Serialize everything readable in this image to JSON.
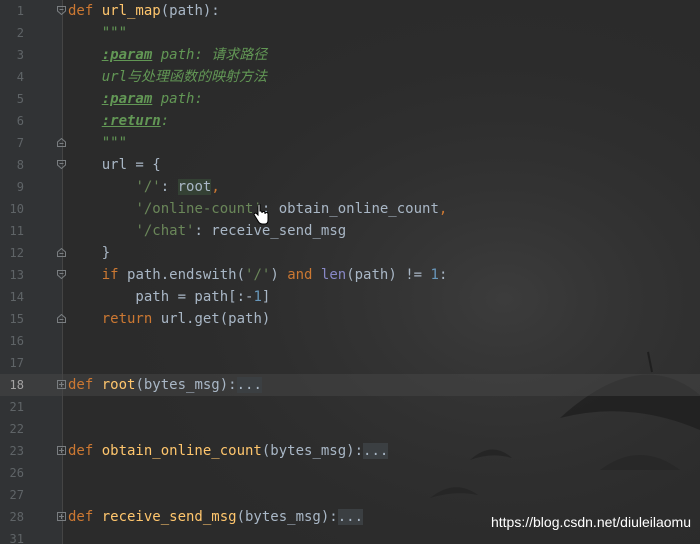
{
  "editor": {
    "lines": [
      {
        "number": "1",
        "fold": "open",
        "tokens": [
          {
            "t": "def ",
            "c": "kw"
          },
          {
            "t": "url_map",
            "c": "fn"
          },
          {
            "t": "(path):",
            "c": "plain"
          }
        ]
      },
      {
        "number": "2",
        "fold": "",
        "tokens": [
          {
            "t": "    \"\"\"",
            "c": "doc"
          }
        ]
      },
      {
        "number": "3",
        "fold": "",
        "tokens": [
          {
            "t": "    ",
            "c": "plain"
          },
          {
            "t": ":param",
            "c": "tag"
          },
          {
            "t": " path: 请求路径",
            "c": "doc"
          }
        ]
      },
      {
        "number": "4",
        "fold": "",
        "tokens": [
          {
            "t": "    url与处理函数的映射方法",
            "c": "doc"
          }
        ]
      },
      {
        "number": "5",
        "fold": "",
        "tokens": [
          {
            "t": "    ",
            "c": "plain"
          },
          {
            "t": ":param",
            "c": "tag"
          },
          {
            "t": " path:",
            "c": "doc"
          }
        ]
      },
      {
        "number": "6",
        "fold": "",
        "tokens": [
          {
            "t": "    ",
            "c": "plain"
          },
          {
            "t": ":return",
            "c": "tag"
          },
          {
            "t": ":",
            "c": "doc"
          }
        ]
      },
      {
        "number": "7",
        "fold": "close",
        "tokens": [
          {
            "t": "    \"\"\"",
            "c": "doc"
          }
        ]
      },
      {
        "number": "8",
        "fold": "open",
        "tokens": [
          {
            "t": "    url = {",
            "c": "plain"
          }
        ]
      },
      {
        "number": "9",
        "fold": "",
        "tokens": [
          {
            "t": "        ",
            "c": "plain"
          },
          {
            "t": "'/'",
            "c": "str"
          },
          {
            "t": ": ",
            "c": "plain"
          },
          {
            "t": "root",
            "c": "hl"
          },
          {
            "t": ",",
            "c": "kw"
          }
        ]
      },
      {
        "number": "10",
        "fold": "",
        "tokens": [
          {
            "t": "        ",
            "c": "plain"
          },
          {
            "t": "'/online-count'",
            "c": "str"
          },
          {
            "t": ": obtain_online_count",
            "c": "plain"
          },
          {
            "t": ",",
            "c": "kw"
          }
        ]
      },
      {
        "number": "11",
        "fold": "",
        "tokens": [
          {
            "t": "        ",
            "c": "plain"
          },
          {
            "t": "'/chat'",
            "c": "str"
          },
          {
            "t": ": receive_send_msg",
            "c": "plain"
          }
        ]
      },
      {
        "number": "12",
        "fold": "close",
        "tokens": [
          {
            "t": "    }",
            "c": "plain"
          }
        ]
      },
      {
        "number": "13",
        "fold": "open",
        "tokens": [
          {
            "t": "    ",
            "c": "plain"
          },
          {
            "t": "if ",
            "c": "kw"
          },
          {
            "t": "path.endswith(",
            "c": "plain"
          },
          {
            "t": "'/'",
            "c": "str"
          },
          {
            "t": ") ",
            "c": "plain"
          },
          {
            "t": "and ",
            "c": "kw"
          },
          {
            "t": "len",
            "c": "builtin"
          },
          {
            "t": "(path) != ",
            "c": "plain"
          },
          {
            "t": "1",
            "c": "num"
          },
          {
            "t": ":",
            "c": "plain"
          }
        ]
      },
      {
        "number": "14",
        "fold": "",
        "tokens": [
          {
            "t": "        path = path[:-",
            "c": "plain"
          },
          {
            "t": "1",
            "c": "num"
          },
          {
            "t": "]",
            "c": "plain"
          }
        ]
      },
      {
        "number": "15",
        "fold": "close",
        "tokens": [
          {
            "t": "    ",
            "c": "plain"
          },
          {
            "t": "return ",
            "c": "kw"
          },
          {
            "t": "url.get(path)",
            "c": "plain"
          }
        ]
      },
      {
        "number": "16",
        "fold": "",
        "tokens": []
      },
      {
        "number": "17",
        "fold": "",
        "tokens": []
      },
      {
        "number": "18",
        "fold": "plus",
        "current": true,
        "tokens": [
          {
            "t": "def ",
            "c": "kw"
          },
          {
            "t": "root",
            "c": "fn"
          },
          {
            "t": "(bytes_msg):",
            "c": "plain"
          },
          {
            "t": "...",
            "c": "folded"
          }
        ]
      },
      {
        "number": "21",
        "fold": "",
        "tokens": []
      },
      {
        "number": "22",
        "fold": "",
        "tokens": []
      },
      {
        "number": "23",
        "fold": "plus",
        "tokens": [
          {
            "t": "def ",
            "c": "kw"
          },
          {
            "t": "obtain_online_count",
            "c": "fn"
          },
          {
            "t": "(bytes_msg):",
            "c": "plain"
          },
          {
            "t": "...",
            "c": "folded"
          }
        ]
      },
      {
        "number": "26",
        "fold": "",
        "tokens": []
      },
      {
        "number": "27",
        "fold": "",
        "tokens": []
      },
      {
        "number": "28",
        "fold": "plus",
        "tokens": [
          {
            "t": "def ",
            "c": "kw"
          },
          {
            "t": "receive_send_msg",
            "c": "fn"
          },
          {
            "t": "(bytes_msg):",
            "c": "plain"
          },
          {
            "t": "...",
            "c": "folded"
          }
        ]
      },
      {
        "number": "31",
        "fold": "",
        "tokens": []
      }
    ]
  },
  "watermark": "https://blog.csdn.net/diuleilaomu",
  "icons": {
    "cursor": "hand-pointer-icon"
  },
  "colors": {
    "background": "#2b2b2b",
    "gutter": "#313335",
    "keyword": "#cc7832",
    "function": "#ffc66d",
    "docstring": "#629755",
    "string": "#6a8759",
    "number": "#6897bb",
    "builtin": "#8888c6",
    "text": "#a9b7c6"
  }
}
